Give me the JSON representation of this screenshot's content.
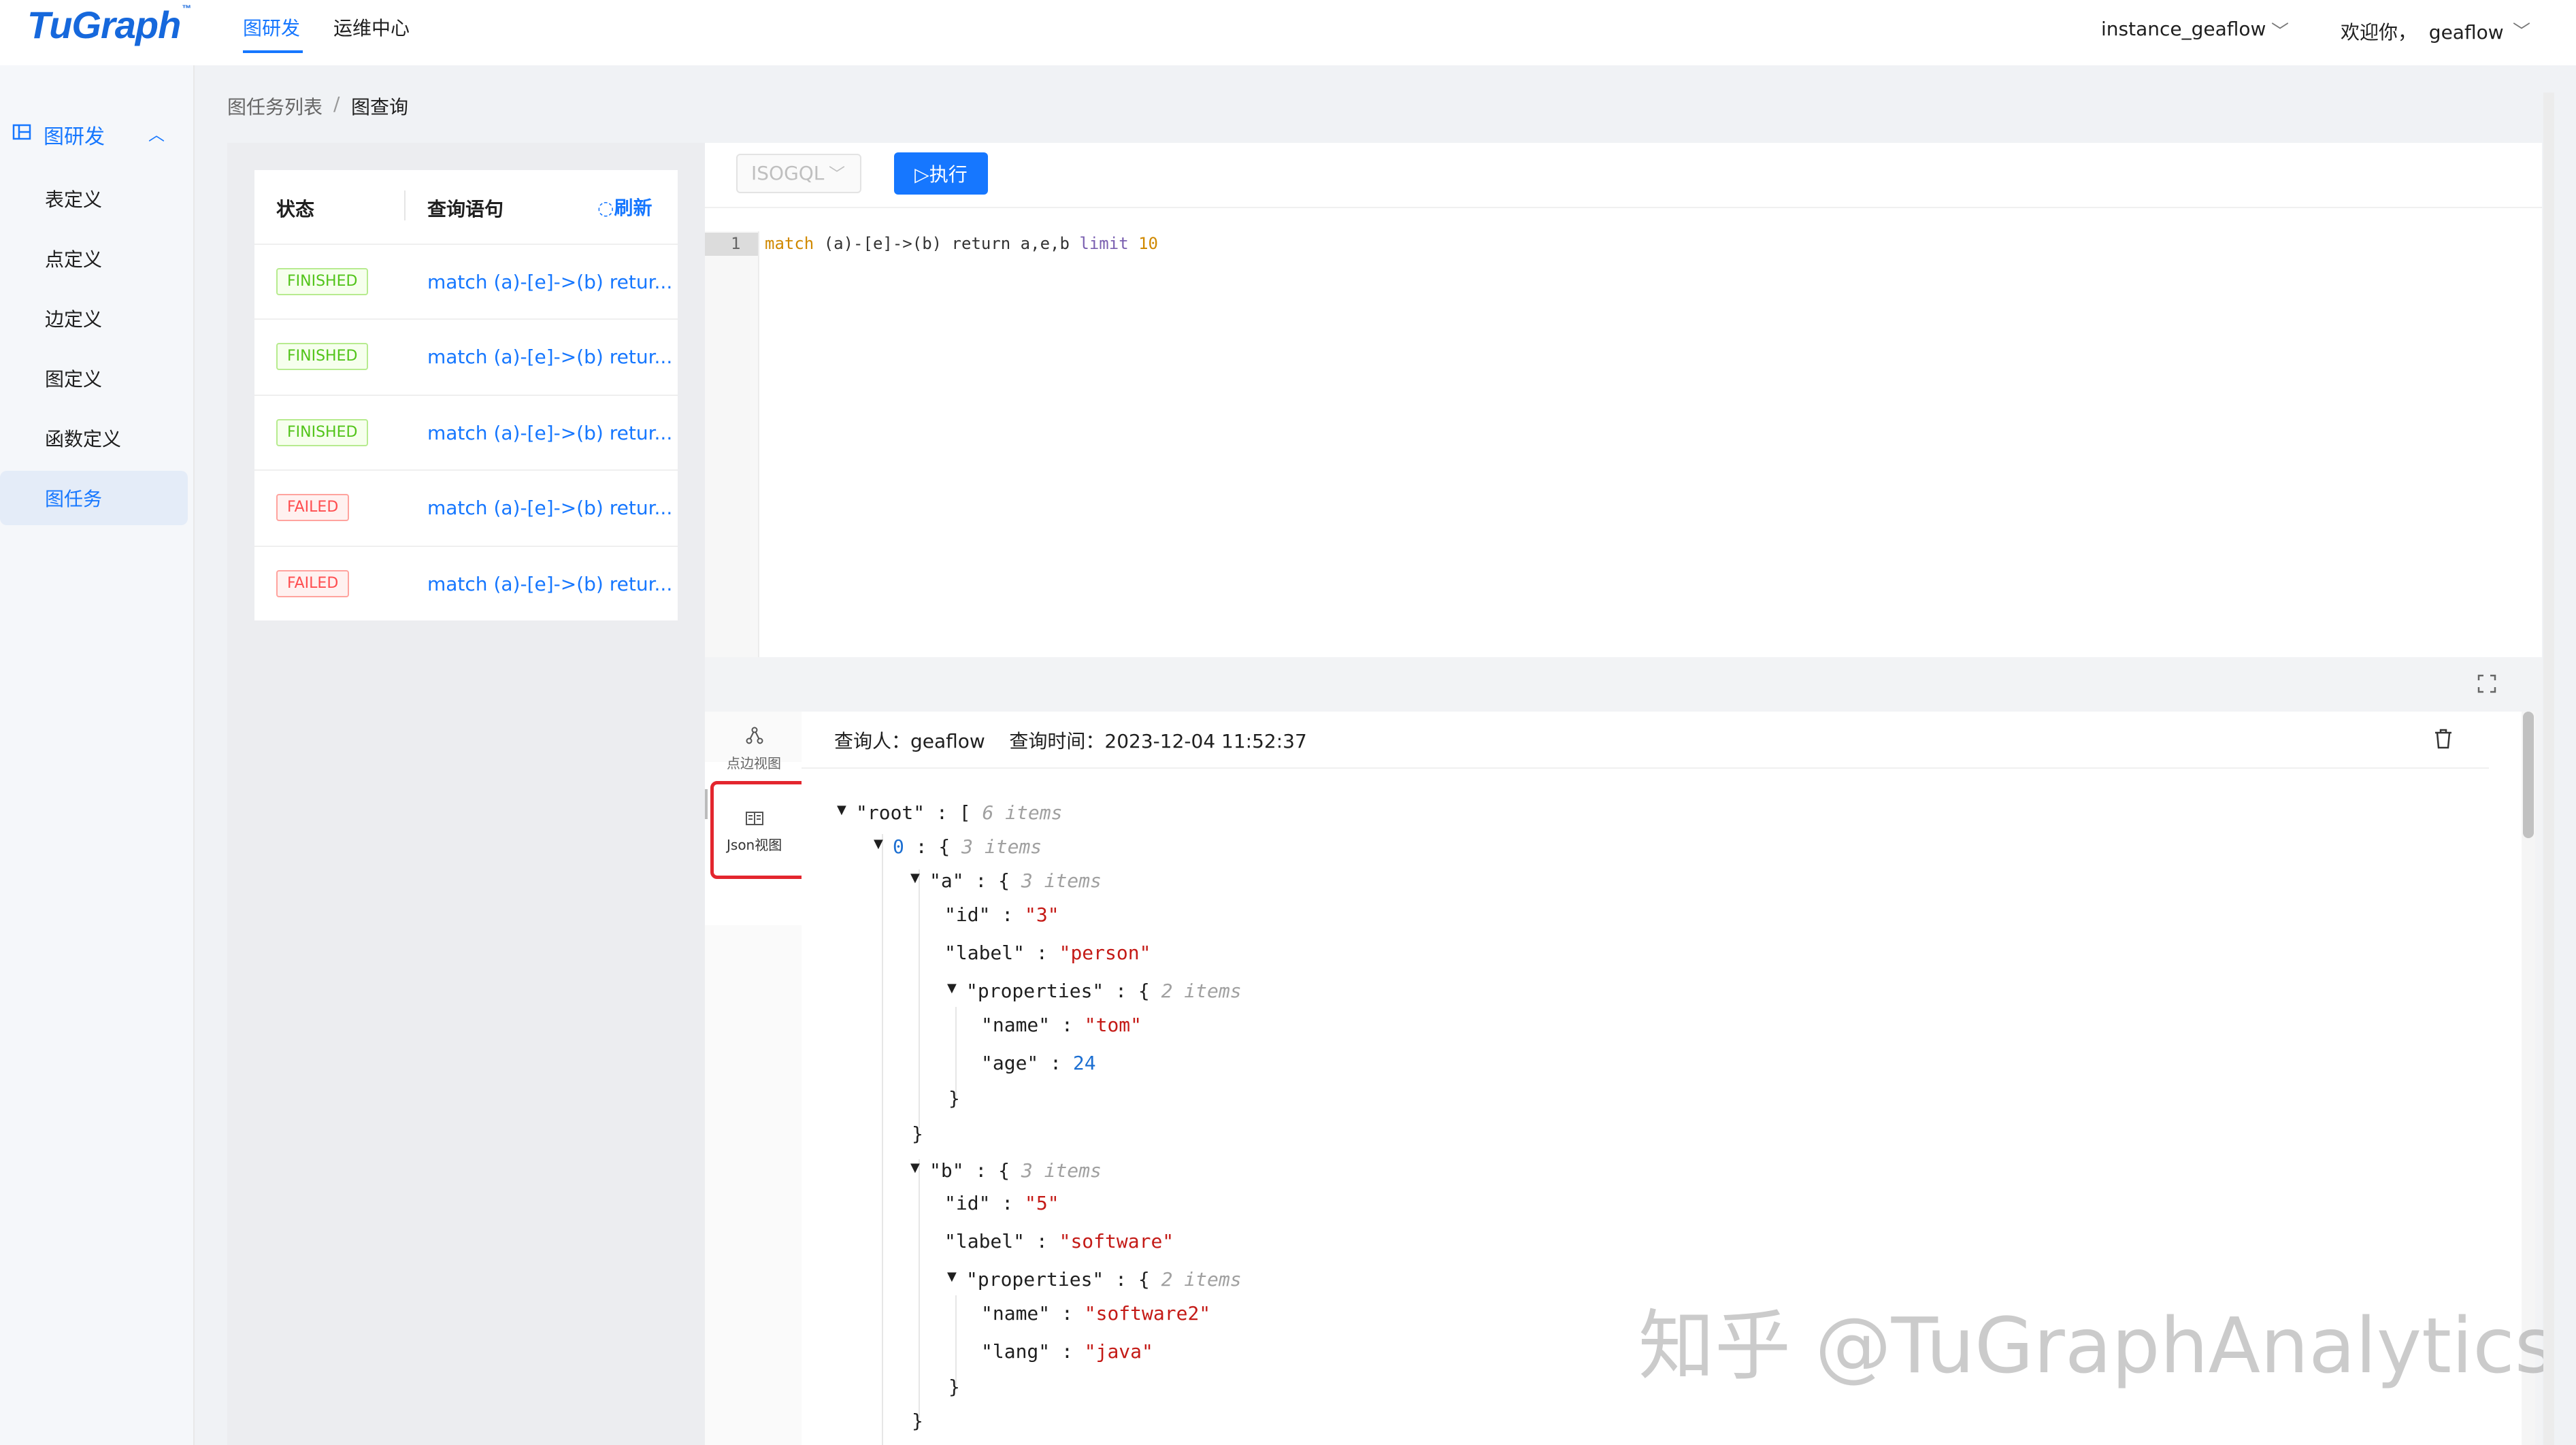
{
  "header": {
    "logo": "TuGraph",
    "logo_tm": "™",
    "nav": [
      "图研发",
      "运维中心"
    ],
    "instance": "instance_geaflow",
    "welcome": "欢迎你，  geaflow"
  },
  "sidebar": {
    "section": "图研发",
    "items": [
      "表定义",
      "点定义",
      "边定义",
      "图定义",
      "函数定义",
      "图任务"
    ]
  },
  "breadcrumb": [
    "图任务列表",
    "/",
    "图查询"
  ],
  "task_list": {
    "col_status": "状态",
    "col_query": "查询语句",
    "refresh": "刷新",
    "rows": [
      {
        "status": "FINISHED",
        "query": "match (a)-[e]->(b) retur..."
      },
      {
        "status": "FINISHED",
        "query": "match (a)-[e]->(b) retur..."
      },
      {
        "status": "FINISHED",
        "query": "match (a)-[e]->(b) retur..."
      },
      {
        "status": "FAILED",
        "query": "match (a)-[e]->(b) retur..."
      },
      {
        "status": "FAILED",
        "query": "match (a)-[e]->(b) retur..."
      }
    ]
  },
  "editor": {
    "language": "ISOGQL",
    "run": "▷执行",
    "line_number": "1",
    "code": {
      "kw": "match",
      "body": " (a)-[e]->(b) return a,e,b ",
      "limit": "limit",
      "num": "10"
    }
  },
  "result": {
    "view_graph": "点边视图",
    "view_json": "Json视图",
    "meta": "查询人：geaflow    查询时间：2023-12-04 11:52:37",
    "json": {
      "root_key": "\"root\"",
      "root_items": "6 items",
      "i0_key": "0",
      "i0_items": "3 items",
      "a_key": "\"a\"",
      "a_items": "3 items",
      "a_id": "\"3\"",
      "a_label": "\"person\"",
      "a_props_items": "2 items",
      "a_name": "\"tom\"",
      "a_age": "24",
      "b_key": "\"b\"",
      "b_items": "3 items",
      "b_id": "\"5\"",
      "b_label": "\"software\"",
      "b_props_items": "2 items",
      "b_name": "\"software2\"",
      "b_lang": "\"java\"",
      "k_id": "\"id\"",
      "k_label": "\"label\"",
      "k_props": "\"properties\"",
      "k_name": "\"name\"",
      "k_age": "\"age\"",
      "k_lang": "\"lang\""
    }
  },
  "watermark": "知乎 @TuGraphAnalytics",
  "colors": {
    "primary": "#1677ff",
    "success": "#52c41a",
    "error": "#ff4d4f",
    "highlight": "#e3262e"
  }
}
